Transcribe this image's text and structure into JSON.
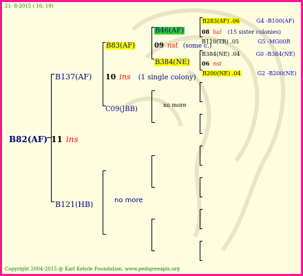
{
  "header": {
    "date_text": "21-  8-2015 ( 16: 19)"
  },
  "footer": {
    "copyright": "Copyright 2004-2015 @ Karl Kehrle Foundation.   www.pedigreeapis.org"
  },
  "pedigree": {
    "root": {
      "name": "B82(AF)",
      "number": "11",
      "mark": "ins"
    },
    "sire": {
      "name": "B137(AF)",
      "number": "10",
      "mark": "ins",
      "note": "(1 single colony)"
    },
    "dam": {
      "name": "B121(HB)",
      "note": "no more"
    },
    "sire_sire": {
      "name": "B83(AF)"
    },
    "sire_dam": {
      "name": "C09(JBB)",
      "note": "no more"
    },
    "ssss": {
      "name": "B46(AF)",
      "number": "09",
      "mark": "nst",
      "note": "(some c.)"
    },
    "sssd": {
      "name": "B384(NE)",
      "number": "06",
      "mark": "nst"
    },
    "g4": [
      {
        "name": "B283(AF) .06",
        "code": "G4 -B100(AF)"
      },
      {
        "name": "08",
        "mark": "bal",
        "note": "(15 sister colonies)"
      },
      {
        "name": "B110(TR) .05",
        "code": "G5 -MG00R"
      },
      {
        "name": "B384(NE) .04",
        "code": "G0 -B384(NE)"
      },
      {
        "name": "B200(NE) .04",
        "code": "G2 -B200(NE)"
      }
    ]
  },
  "colors": {
    "border": "#ff1493",
    "background": "#fffde0",
    "highlight": "#ffff00",
    "highlight_green": "#33cc33"
  }
}
